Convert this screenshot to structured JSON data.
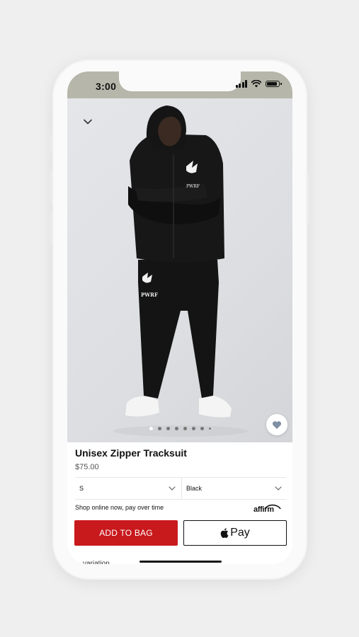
{
  "status_bar": {
    "time": "3:00"
  },
  "product": {
    "title": "Unisex Zipper Tracksuit",
    "price": "$75.00",
    "image_alt": "Model wearing black PWRF zipper tracksuit",
    "image_logo": "PWRF",
    "carousel": {
      "total": 8,
      "active_index": 0
    }
  },
  "options": {
    "size_value": "S",
    "color_value": "Black"
  },
  "financing": {
    "text": "Shop online now, pay over time",
    "provider": "affirm"
  },
  "actions": {
    "add_to_bag": "ADD TO BAG",
    "apple_pay": "Pay"
  },
  "below_fold": {
    "section_peek": "variation"
  },
  "colors": {
    "accent_red": "#c8191d",
    "status_bar": "#b6b7aa",
    "background": "#efefef"
  }
}
